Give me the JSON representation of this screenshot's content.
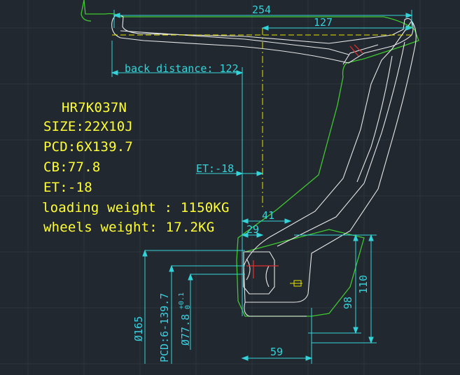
{
  "spec": {
    "model": "HR7K037N",
    "size": "SIZE:22X10J",
    "pcd": "PCD:6X139.7",
    "cb": "CB:77.8",
    "et": "ET:-18",
    "loading_weight": "loading weight : 1150KG",
    "wheels_weight": "wheels weight: 17.2KG"
  },
  "dimensions": {
    "overall_width": "254",
    "half_width": "127",
    "back_distance": "back distance: 122",
    "et_label": "ET:-18",
    "dim_41": "41",
    "dim_29": "29",
    "dim_59": "59",
    "dim_110": "110",
    "dim_98": "98",
    "dia_165": "Ø165",
    "pcd_vertical": "PCD:6-139.7",
    "cb_vertical": "Ø77.8",
    "cb_tol_upper": "+0.1",
    "cb_tol_lower": "0"
  },
  "colors": {
    "background": "#212830",
    "text_yellow": "#ffff33",
    "dimension_cyan": "#33d4d9",
    "outline_green": "#3fc92f",
    "profile_white": "#e8e8e8",
    "centerline_yellow": "#e6e600",
    "accent_red": "#e03030"
  }
}
